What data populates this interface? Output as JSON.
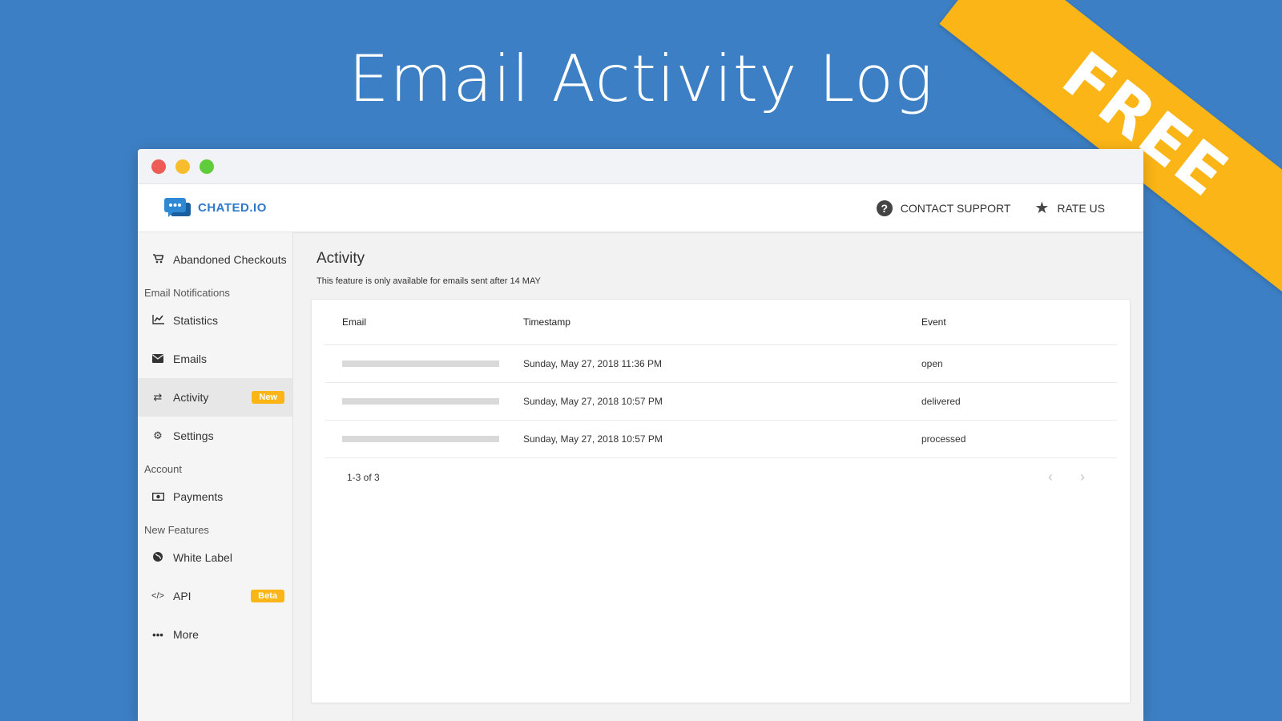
{
  "hero": {
    "title": "Email Activity Log",
    "ribbon": "FREE"
  },
  "colors": {
    "background": "#3d7fc4",
    "ribbon": "#fbb516",
    "brand": "#2f79c8",
    "badge": "#fbb516"
  },
  "header": {
    "brand": "CHATED.IO",
    "contact_support": "CONTACT SUPPORT",
    "rate_us": "RATE US"
  },
  "sidebar": {
    "abandoned": "Abandoned Checkouts",
    "section_email": "Email Notifications",
    "statistics": "Statistics",
    "emails": "Emails",
    "activity": "Activity",
    "activity_badge": "New",
    "settings": "Settings",
    "section_account": "Account",
    "payments": "Payments",
    "section_features": "New Features",
    "white_label": "White Label",
    "api": "API",
    "api_badge": "Beta",
    "more": "More"
  },
  "main": {
    "title": "Activity",
    "subtitle": "This feature is only available for emails sent after 14 MAY",
    "columns": {
      "email": "Email",
      "timestamp": "Timestamp",
      "event": "Event"
    },
    "rows": [
      {
        "timestamp": "Sunday, May 27, 2018 11:36 PM",
        "event": "open"
      },
      {
        "timestamp": "Sunday, May 27, 2018 10:57 PM",
        "event": "delivered"
      },
      {
        "timestamp": "Sunday, May 27, 2018 10:57 PM",
        "event": "processed"
      }
    ],
    "pagination": "1-3 of 3"
  }
}
